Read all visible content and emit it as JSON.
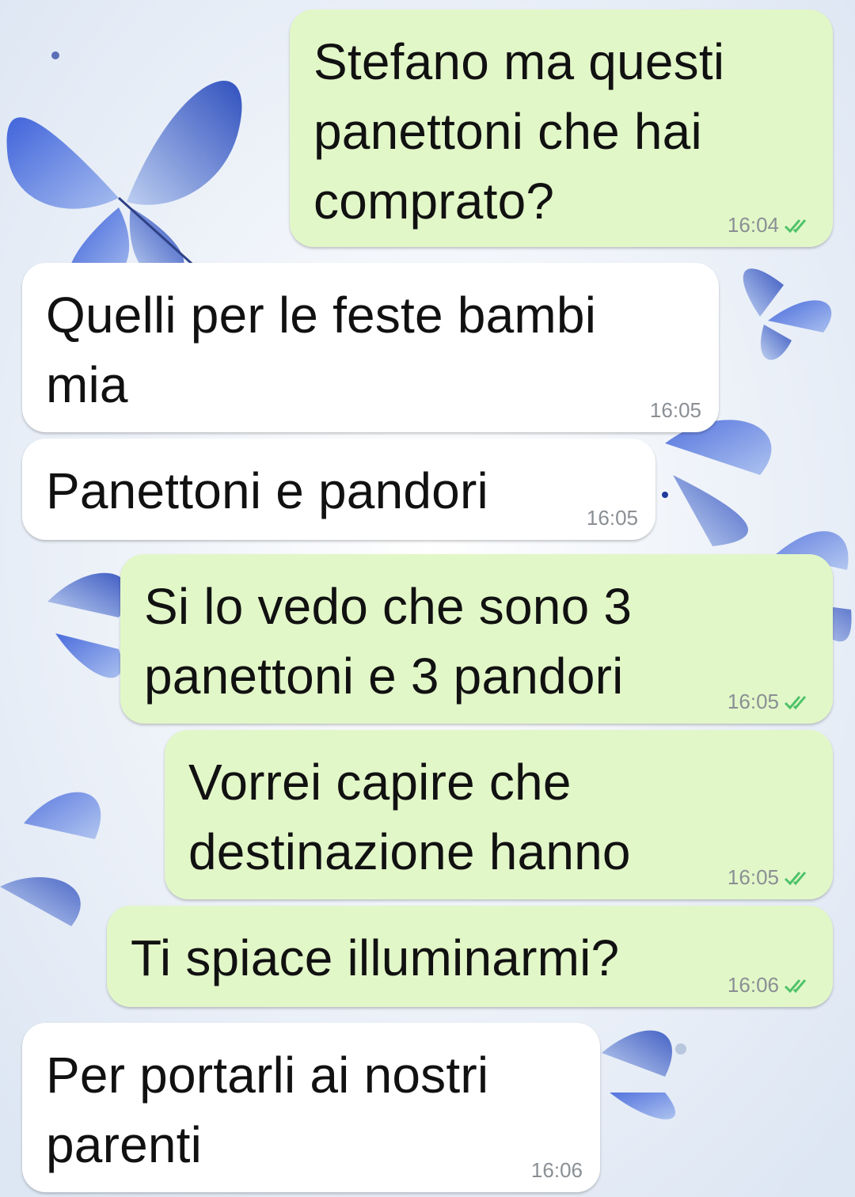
{
  "chat": {
    "accent_outgoing": "#e2f7c8",
    "accent_incoming": "#ffffff",
    "read_check_color": "#4fc36a",
    "messages": [
      {
        "direction": "outgoing",
        "text": "Stefano ma questi\npanettoni che hai\ncomprato?",
        "time": "16:04",
        "status": "read"
      },
      {
        "direction": "incoming",
        "text": "Quelli per le feste bambi\nmia",
        "time": "16:05"
      },
      {
        "direction": "incoming",
        "text": "Panettoni e pandori",
        "time": "16:05"
      },
      {
        "direction": "outgoing",
        "text": "Si lo vedo che sono 3\npanettoni e 3 pandori",
        "time": "16:05",
        "status": "read"
      },
      {
        "direction": "outgoing",
        "text": "Vorrei capire che\ndestinazione hanno",
        "time": "16:05",
        "status": "read"
      },
      {
        "direction": "outgoing",
        "text": "Ti spiace illuminarmi?",
        "time": "16:06",
        "status": "read"
      },
      {
        "direction": "incoming",
        "text": "Per portarli ai nostri\nparenti",
        "time": "16:06"
      }
    ]
  },
  "icons": {
    "read_receipt": "double-check-icon",
    "wallpaper": "blue-butterflies-wallpaper"
  }
}
